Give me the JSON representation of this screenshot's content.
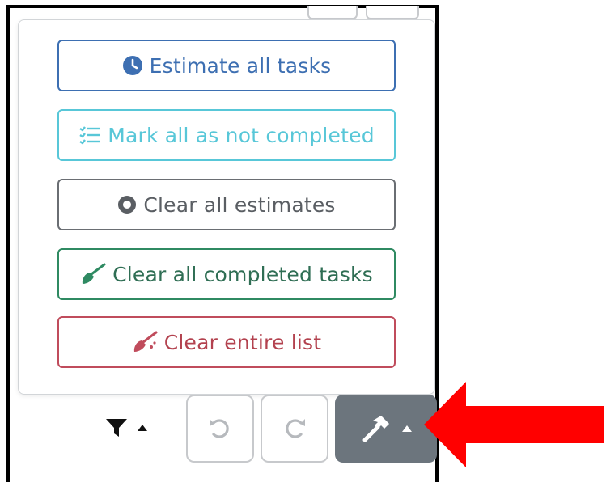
{
  "menu": {
    "items": [
      {
        "label": "Estimate all tasks",
        "icon": "clock-icon",
        "color": "#3d6fb2"
      },
      {
        "label": "Mark all as not completed",
        "icon": "list-icon",
        "color": "#58c7d8"
      },
      {
        "label": "Clear all estimates",
        "icon": "circle-icon",
        "color": "#5a5e63"
      },
      {
        "label": "Clear all completed tasks",
        "icon": "broom-icon",
        "color": "#2f8a62"
      },
      {
        "label": "Clear entire list",
        "icon": "broom-icon",
        "color": "#c04c5c"
      }
    ]
  },
  "toolbar": {
    "filter_icon": "filter-icon",
    "undo_icon": "undo-icon",
    "redo_icon": "redo-icon",
    "tools_icon": "hammer-icon",
    "tools_bg": "#6c757d"
  },
  "annotation": {
    "arrow_color": "#ff0000"
  }
}
